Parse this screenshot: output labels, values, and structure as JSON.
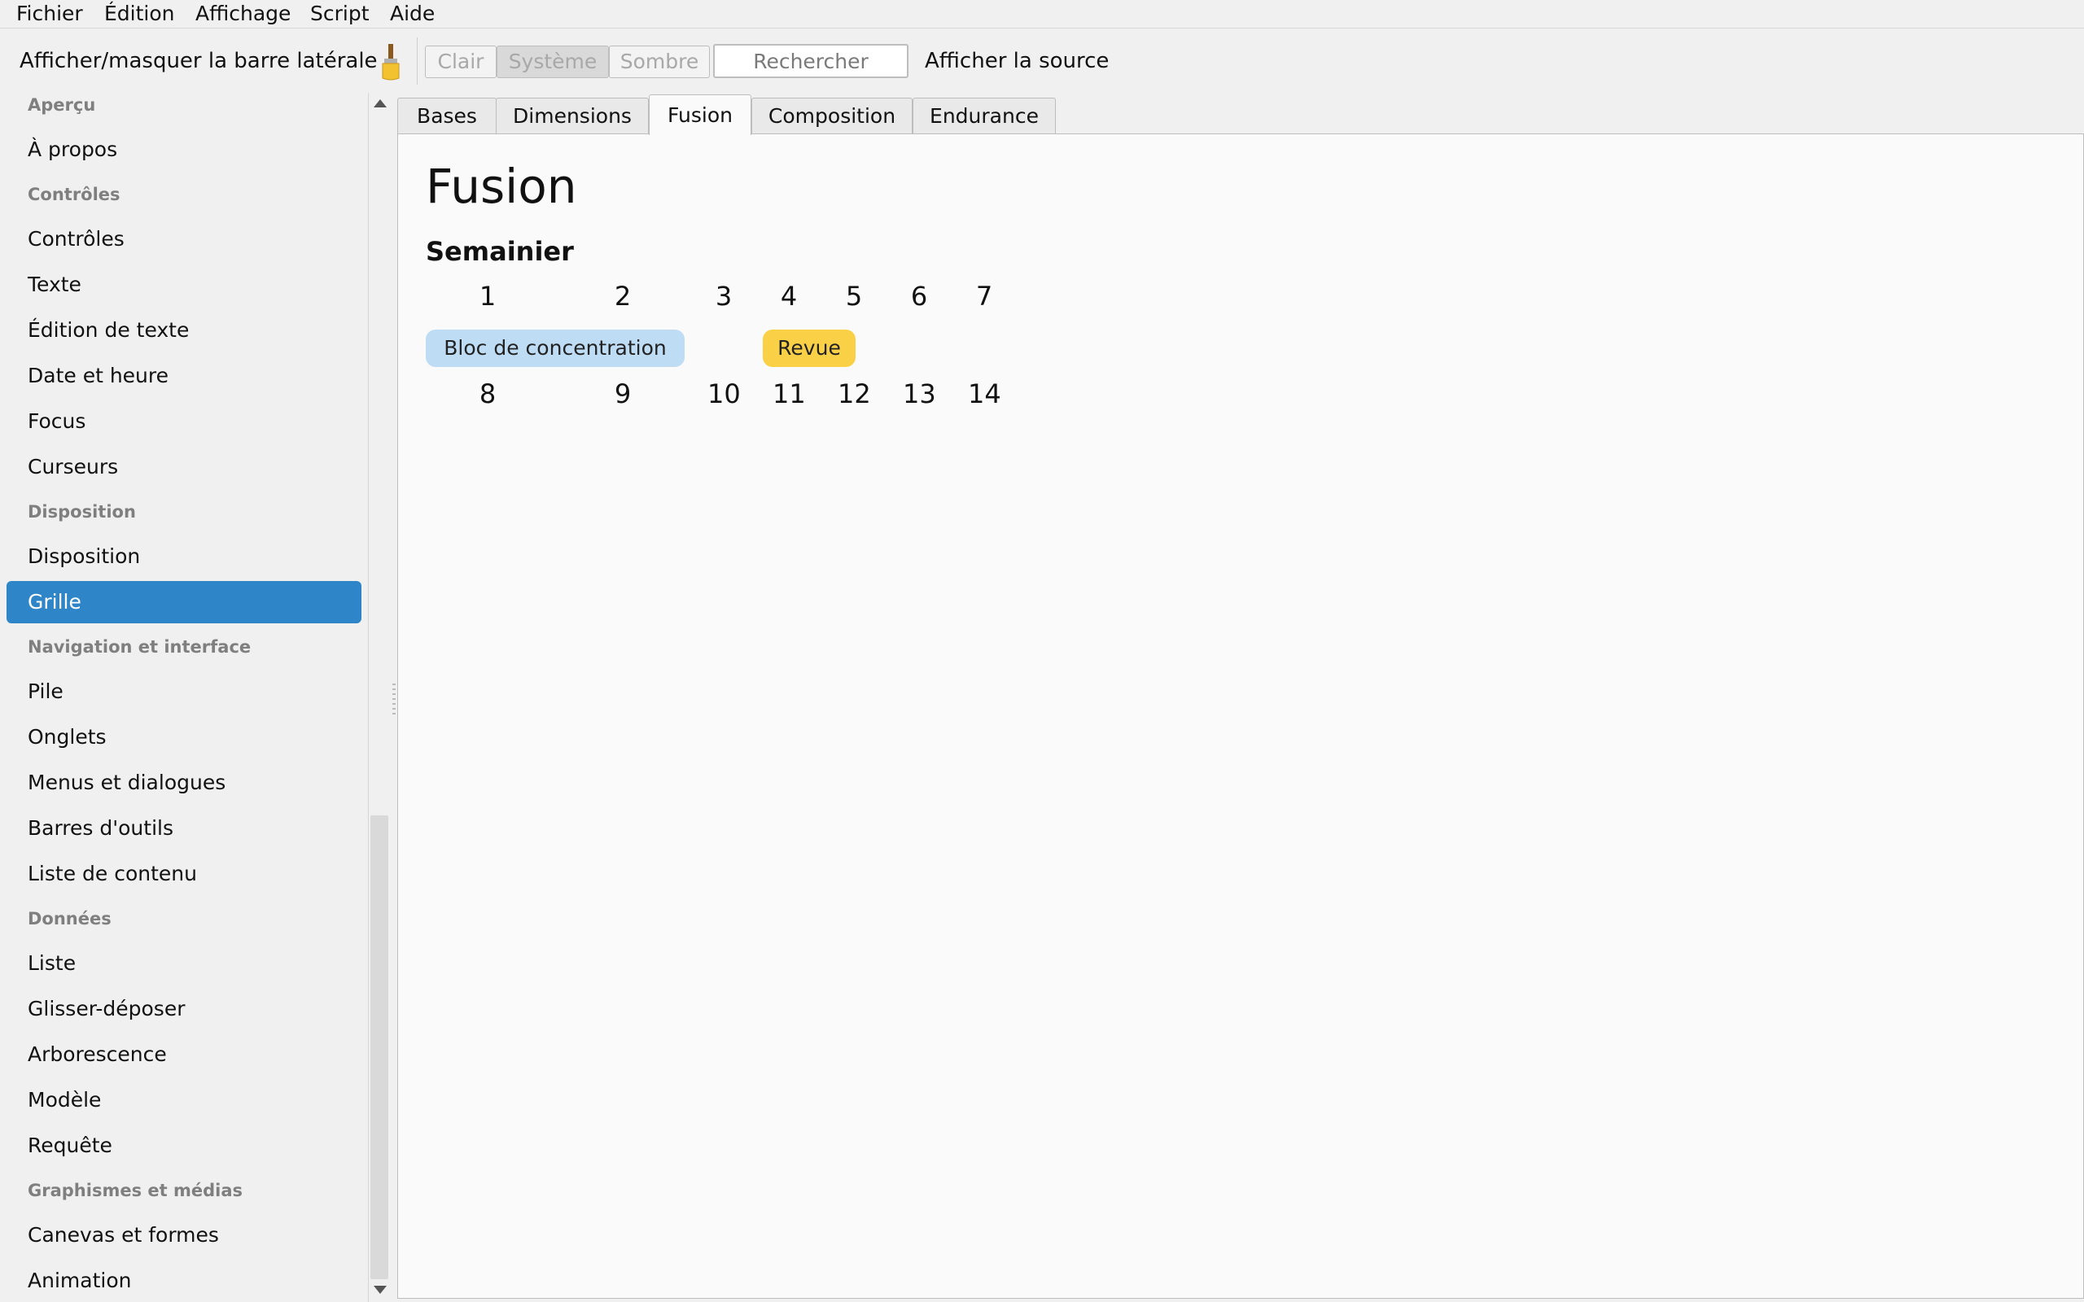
{
  "menu": [
    "Fichier",
    "Édition",
    "Affichage",
    "Script",
    "Aide"
  ],
  "toolbar": {
    "toggle_sidebar": "Afficher/masquer la barre latérale",
    "brush_icon": "paintbrush-icon",
    "theme": {
      "light": "Clair",
      "system": "Système",
      "dark": "Sombre",
      "selected": "Système"
    },
    "search_placeholder": "Rechercher",
    "show_source": "Afficher la source"
  },
  "sidebar": {
    "sections": [
      {
        "title": "Aperçu",
        "items": [
          "À propos"
        ]
      },
      {
        "title": "Contrôles",
        "items": [
          "Contrôles",
          "Texte",
          "Édition de texte",
          "Date et heure",
          "Focus",
          "Curseurs"
        ]
      },
      {
        "title": "Disposition",
        "items": [
          "Disposition",
          "Grille"
        ]
      },
      {
        "title": "Navigation et interface",
        "items": [
          "Pile",
          "Onglets",
          "Menus et dialogues",
          "Barres d'outils",
          "Liste de contenu"
        ]
      },
      {
        "title": "Données",
        "items": [
          "Liste",
          "Glisser-déposer",
          "Arborescence",
          "Modèle",
          "Requête"
        ]
      },
      {
        "title": "Graphismes et médias",
        "items": [
          "Canevas et formes",
          "Animation"
        ]
      }
    ],
    "active_item": "Grille"
  },
  "tabs": [
    "Bases",
    "Dimensions",
    "Fusion",
    "Composition",
    "Endurance"
  ],
  "active_tab": "Fusion",
  "content": {
    "title": "Fusion",
    "section": "Semainier",
    "week1": [
      "1",
      "2",
      "3",
      "4",
      "5",
      "6",
      "7"
    ],
    "week2": [
      "8",
      "9",
      "10",
      "11",
      "12",
      "13",
      "14"
    ],
    "events": [
      {
        "label": "Bloc de concentration",
        "color": "#bfdcf5"
      },
      {
        "label": "Revue",
        "color": "#fad146"
      }
    ]
  }
}
